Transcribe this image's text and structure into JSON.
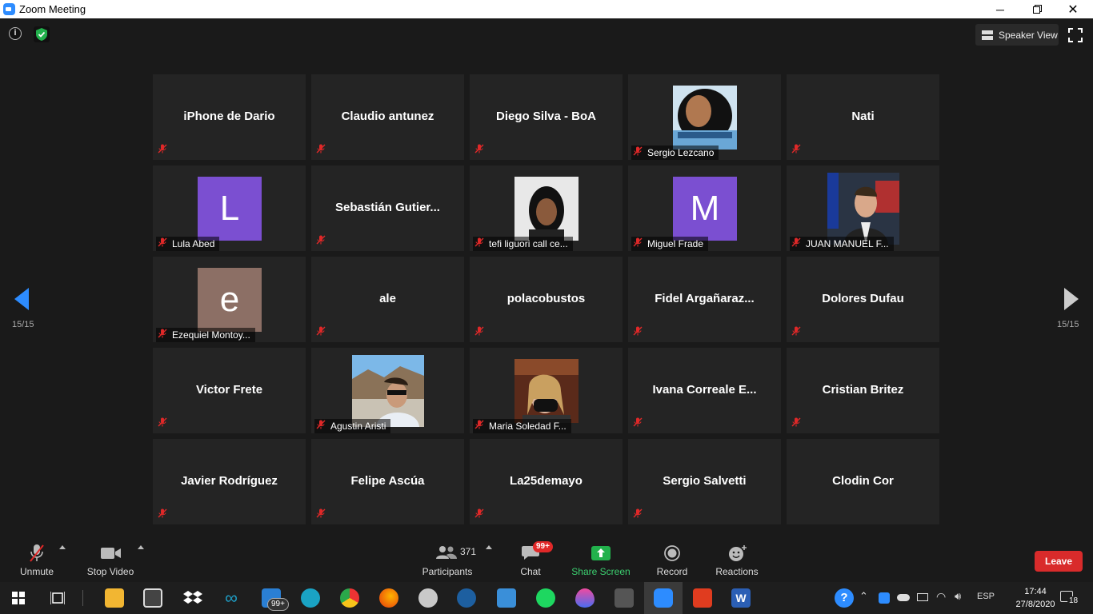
{
  "window": {
    "title": "Zoom Meeting"
  },
  "topbar": {
    "speaker_view_label": "Speaker View"
  },
  "pagination": {
    "left": "15/15",
    "right": "15/15"
  },
  "participants": [
    {
      "name": "iPhone de Dario",
      "type": "name"
    },
    {
      "name": "Claudio antunez",
      "type": "name"
    },
    {
      "name": "Diego Silva - BoA",
      "type": "name"
    },
    {
      "name": "Sergio Lezcano",
      "type": "photo",
      "photo": "sergio"
    },
    {
      "name": "Nati",
      "type": "name"
    },
    {
      "name": "Lula Abed",
      "type": "avatar",
      "initial": "L",
      "color": "#7b4fd1"
    },
    {
      "name": "Sebastián  Gutier...",
      "type": "name"
    },
    {
      "name": "tefi liguori call ce...",
      "type": "photo",
      "photo": "tefi"
    },
    {
      "name": "Miguel Frade",
      "type": "avatar",
      "initial": "M",
      "color": "#7b4fd1"
    },
    {
      "name": "JUAN MANUEL F...",
      "type": "photo",
      "photo": "juan"
    },
    {
      "name": "Ezequiel Montoy...",
      "type": "avatar",
      "initial": "e",
      "color": "#8c6f65"
    },
    {
      "name": "ale",
      "type": "name"
    },
    {
      "name": "polacobustos",
      "type": "name"
    },
    {
      "name": "Fidel  Argañaraz...",
      "type": "name"
    },
    {
      "name": "Dolores Dufau",
      "type": "name"
    },
    {
      "name": "Victor Frete",
      "type": "name"
    },
    {
      "name": "Agustin Aristi",
      "type": "photo",
      "photo": "agustin"
    },
    {
      "name": "Maria Soledad F...",
      "type": "photo",
      "photo": "maria"
    },
    {
      "name": "Ivana Correale E...",
      "type": "name"
    },
    {
      "name": "Cristian Britez",
      "type": "name"
    },
    {
      "name": "Javier Rodríguez",
      "type": "name"
    },
    {
      "name": "Felipe Ascúa",
      "type": "name"
    },
    {
      "name": "La25demayo",
      "type": "name"
    },
    {
      "name": "Sergio Salvetti",
      "type": "name"
    },
    {
      "name": "Clodin Cor",
      "type": "name",
      "no_mic": true
    }
  ],
  "toolbar": {
    "unmute": "Unmute",
    "stop_video": "Stop Video",
    "participants": "Participants",
    "participants_count": "371",
    "chat": "Chat",
    "chat_badge": "99+",
    "share_screen": "Share Screen",
    "record": "Record",
    "reactions": "Reactions",
    "leave": "Leave"
  },
  "taskbar": {
    "mail_badge": "99+",
    "language": "ESP",
    "time": "17:44",
    "date": "27/8/2020",
    "notifications": "18"
  },
  "colors": {
    "accent": "#2d8cff",
    "share_green": "#22c55e",
    "leave_red": "#d92b2b"
  }
}
